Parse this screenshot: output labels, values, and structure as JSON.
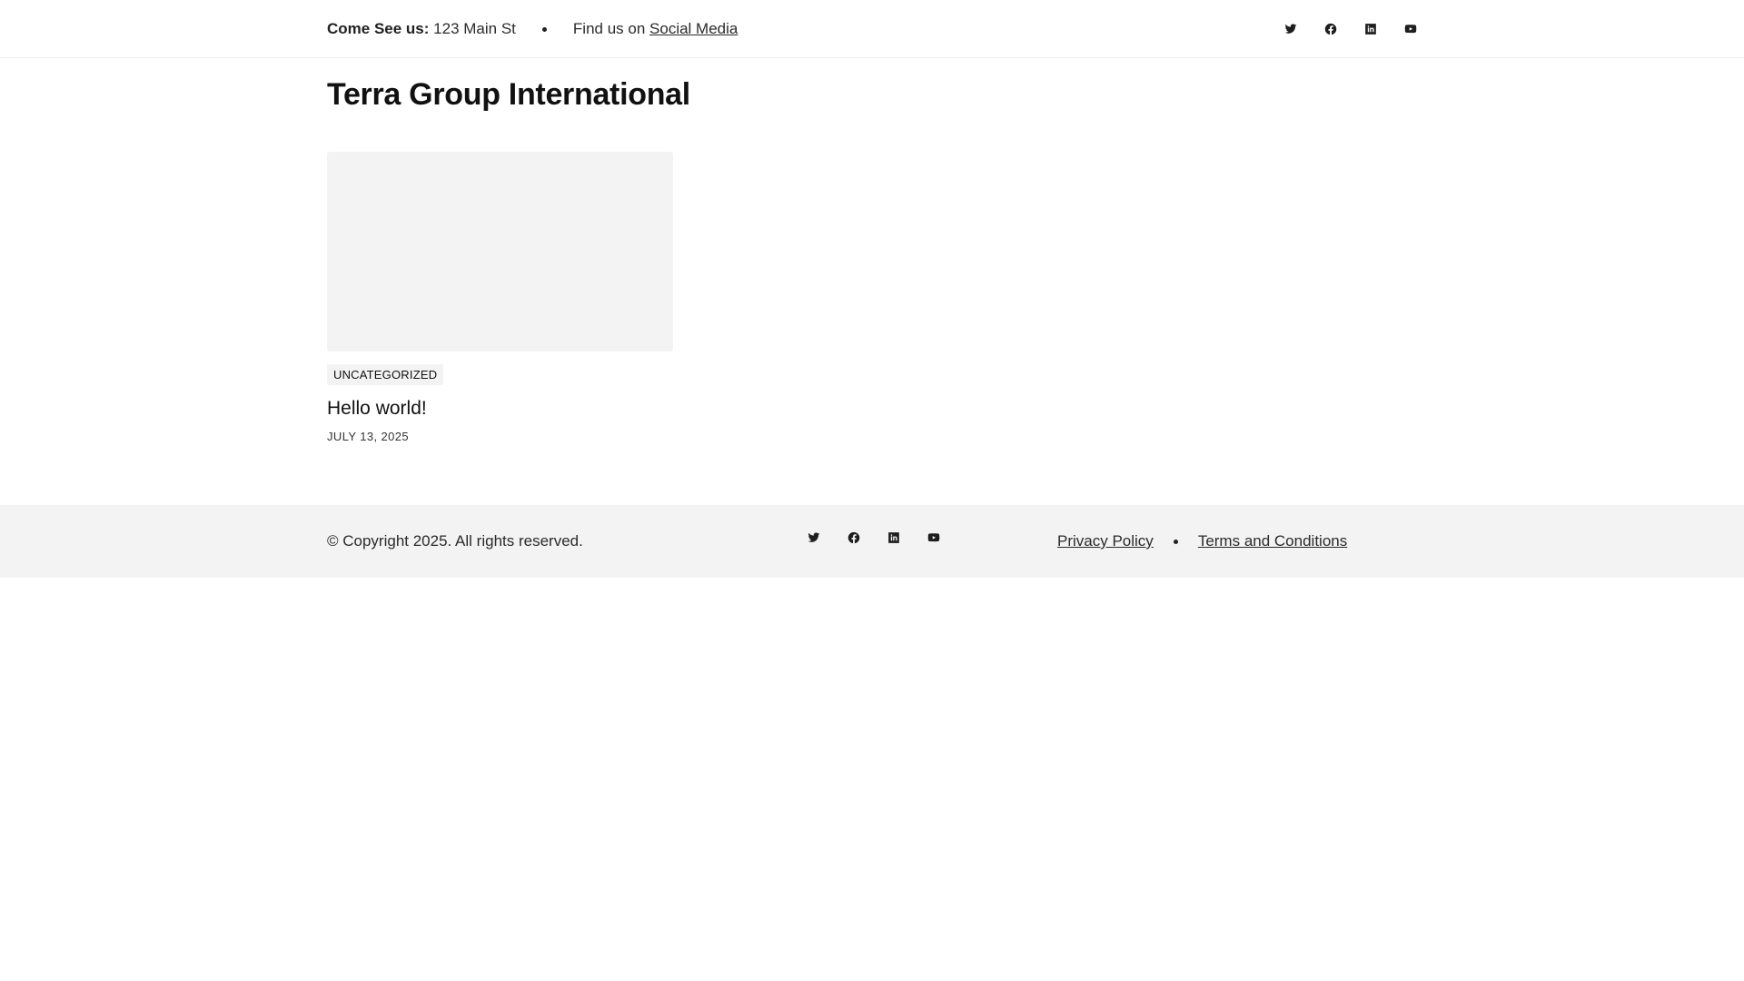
{
  "topbar": {
    "address_label": "Come See us:",
    "address_value": "123 Main St",
    "find_us_prefix": "Find us on",
    "find_us_link": "Social Media",
    "social_icons": [
      "twitter-icon",
      "facebook-icon",
      "linkedin-icon",
      "youtube-icon"
    ]
  },
  "site": {
    "title": "Terra Group International"
  },
  "posts": [
    {
      "category": "UNCATEGORIZED",
      "title": "Hello world!",
      "date": "JULY 13, 2025"
    }
  ],
  "footer": {
    "copyright": "© Copyright 2025. All rights reserved.",
    "social_icons": [
      "twitter-icon",
      "facebook-icon",
      "linkedin-icon",
      "youtube-icon"
    ],
    "links": {
      "privacy": "Privacy Policy",
      "terms": "Terms and Conditions"
    }
  },
  "colors": {
    "background": "#ffffff",
    "panel": "#f3f3f3",
    "text": "#111111"
  }
}
